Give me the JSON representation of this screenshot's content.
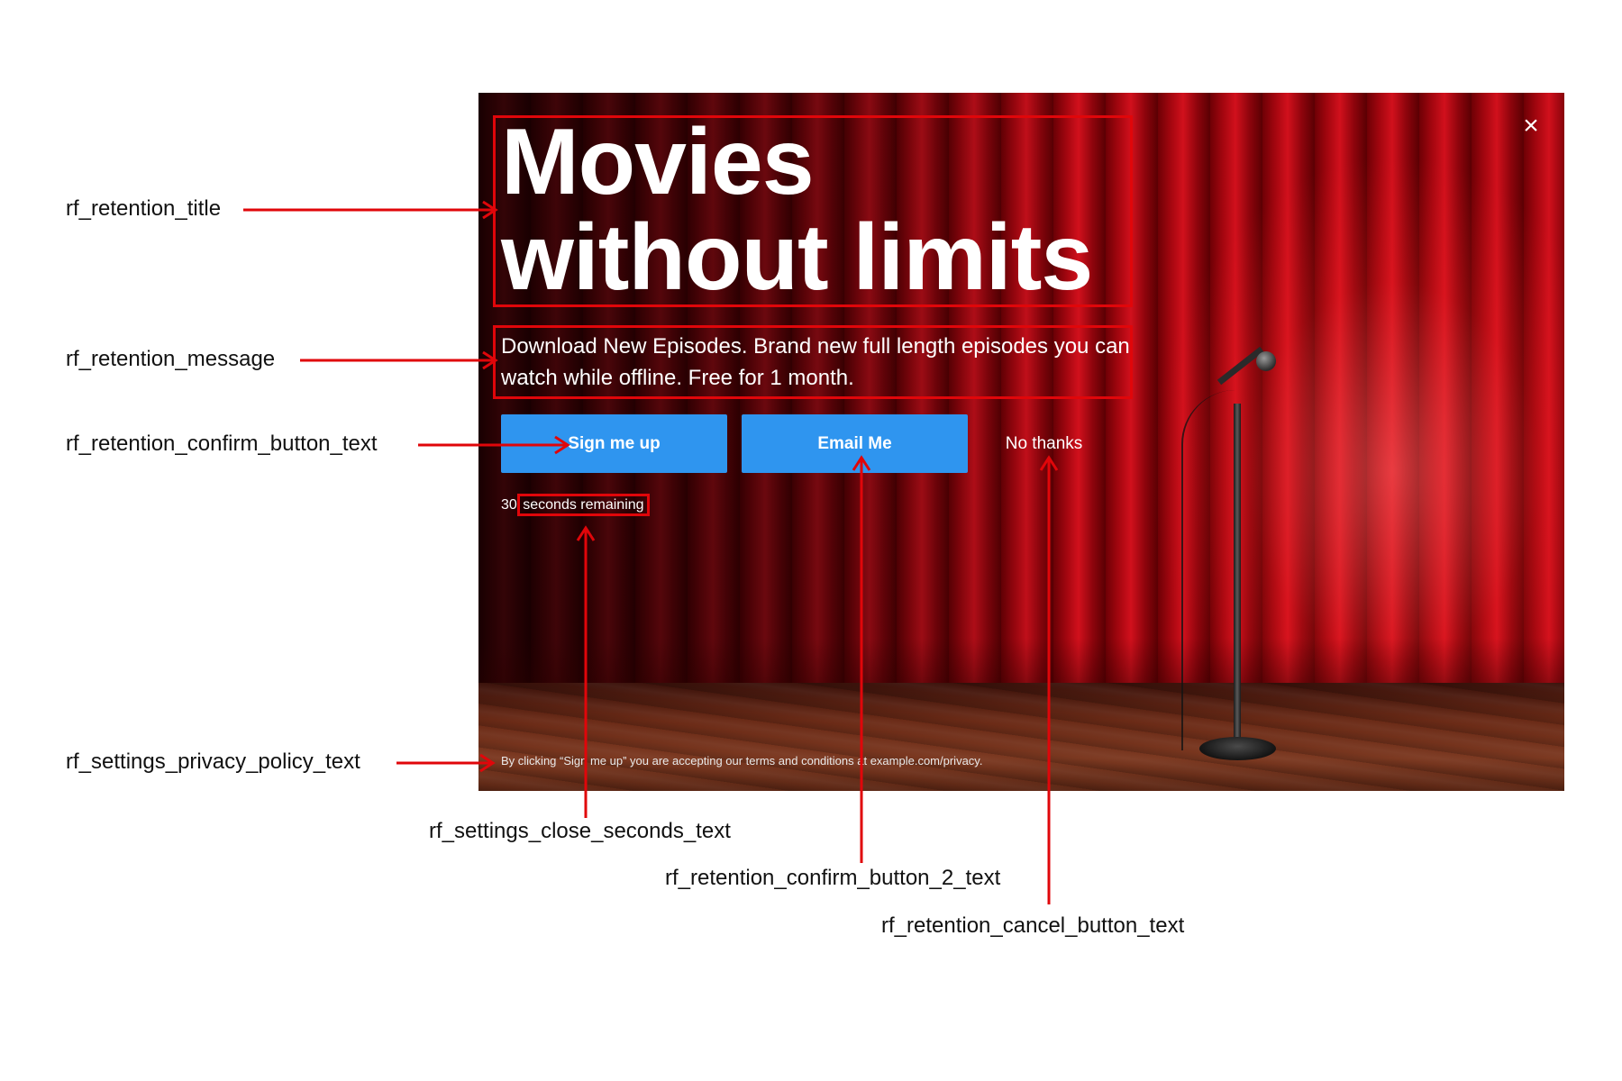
{
  "modal": {
    "title": "Movies without limits",
    "message": "Download New Episodes. Brand new full length episodes you can watch while offline. Free for 1 month.",
    "confirm_button_text": "Sign me up",
    "confirm_button_2_text": "Email Me",
    "cancel_button_text": "No thanks",
    "countdown_number": "30",
    "countdown_text": "seconds remaining",
    "privacy_text": "By clicking “Sign me up” you are accepting our terms and conditions at example.com/privacy.",
    "close_icon": "×",
    "button_color": "#2f95ef"
  },
  "annotations": {
    "title": "rf_retention_title",
    "message": "rf_retention_message",
    "confirm_button": "rf_retention_confirm_button_text",
    "privacy": "rf_settings_privacy_policy_text",
    "close_seconds": "rf_settings_close_seconds_text",
    "confirm_button_2": "rf_retention_confirm_button_2_text",
    "cancel_button": "rf_retention_cancel_button_text",
    "highlight_color": "#e0060a"
  }
}
